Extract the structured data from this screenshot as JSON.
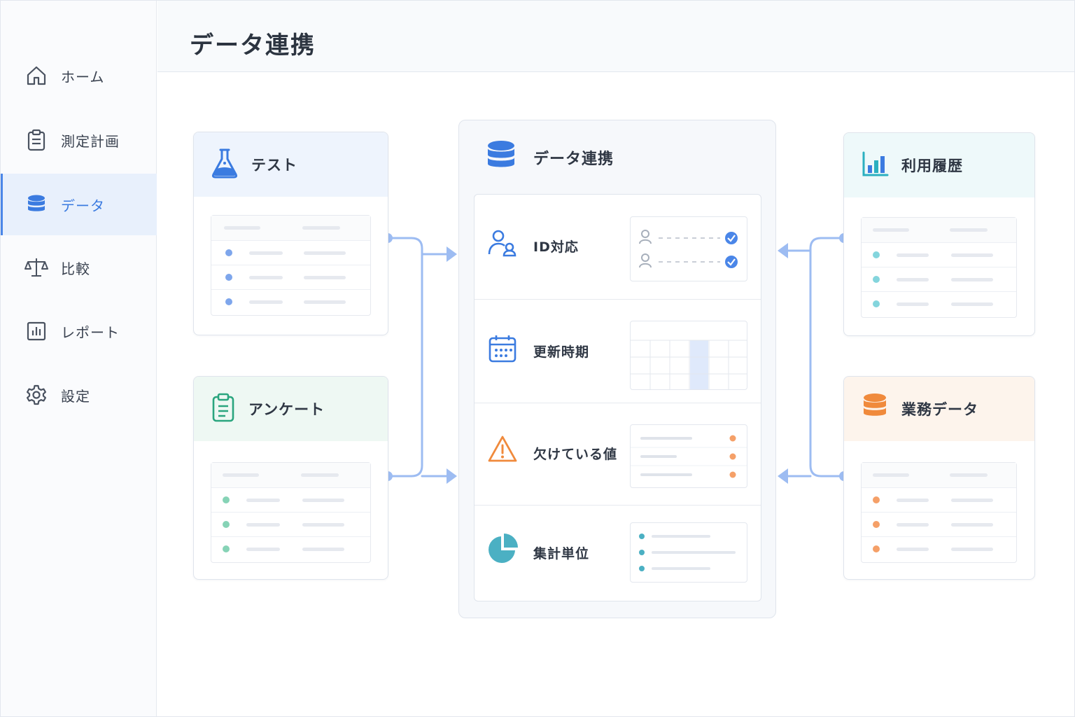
{
  "page_title": "データ連携",
  "sidebar": {
    "items": [
      {
        "label": "ホーム",
        "icon": "home-icon",
        "active": false
      },
      {
        "label": "測定計画",
        "icon": "clipboard-icon",
        "active": false
      },
      {
        "label": "データ",
        "icon": "database-icon",
        "active": true
      },
      {
        "label": "比較",
        "icon": "scale-icon",
        "active": false
      },
      {
        "label": "レポート",
        "icon": "bar-chart-icon",
        "active": false
      },
      {
        "label": "設定",
        "icon": "gear-icon",
        "active": false
      }
    ]
  },
  "sources_left": [
    {
      "title": "テスト",
      "icon": "flask-icon",
      "accent": "#3b7be0",
      "head_bg": "#eef4fd"
    },
    {
      "title": "アンケート",
      "icon": "clipboard-check-icon",
      "accent": "#2aa57e",
      "head_bg": "#eef8f3"
    }
  ],
  "sources_right": [
    {
      "title": "利用履歴",
      "icon": "bar-chart-icon",
      "accent": "#2bb0c0",
      "head_bg": "#eef9fa"
    },
    {
      "title": "業務データ",
      "icon": "database-icon",
      "accent": "#f08a3c",
      "head_bg": "#fdf4ec"
    }
  ],
  "center": {
    "title": "データ連携",
    "icon": "database-icon",
    "sections": [
      {
        "label": "ID対応",
        "icon": "users-icon"
      },
      {
        "label": "更新時期",
        "icon": "calendar-icon"
      },
      {
        "label": "欠けている値",
        "icon": "warning-icon"
      },
      {
        "label": "集計単位",
        "icon": "pie-chart-icon"
      }
    ]
  },
  "colors": {
    "primary": "#3b7be0",
    "connector": "#9dbcf2",
    "green": "#6cc9a6",
    "teal": "#6fcfd8",
    "orange": "#f5a068",
    "warning": "#f08a3c"
  }
}
